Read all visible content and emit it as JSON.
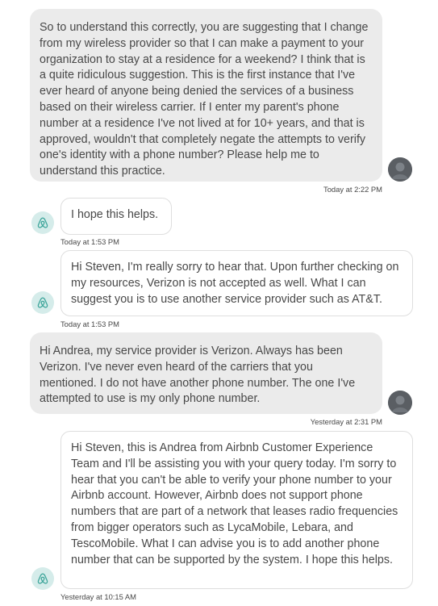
{
  "messages": [
    {
      "sender": "user",
      "text": "So to understand this correctly, you are suggesting that I change from my wireless provider so that I can make a payment to your organization to stay at a residence for a weekend? I think that is a quite ridiculous suggestion. This is the first instance that I've ever heard of anyone being denied the services of a business based on their wireless carrier. If I enter my parent's phone number at a residence I've not lived at for 10+ years, and that is approved, wouldn't that completely negate the attempts to verify one's identity with a phone number? Please help me to understand this practice.",
      "timestamp": "Today at 2:22 PM"
    },
    {
      "sender": "agent",
      "text": "I hope this helps.",
      "timestamp": "Today at 1:53 PM"
    },
    {
      "sender": "agent",
      "text": "Hi Steven, I'm really sorry to hear that. Upon further checking on my resources, Verizon is not accepted as well. What I can suggest you is to use another service provider such as AT&T.",
      "timestamp": "Today at 1:53 PM"
    },
    {
      "sender": "user",
      "text": "Hi Andrea, my service provider is Verizon. Always has been Verizon. I've never even heard of the carriers that you mentioned. I do not have another phone number. The one I've attempted to use is my only phone number.",
      "timestamp": "Yesterday at 2:31 PM"
    },
    {
      "sender": "agent",
      "text": "Hi Steven, this is Andrea from Airbnb Customer Experience Team and I'll be assisting you with your query today. I'm sorry to hear that you can't be able to verify your phone number to your Airbnb account. However, Airbnb does not support phone numbers that are part of a network that leases radio frequencies from bigger operators such as LycaMobile, Lebara, and TescoMobile. What I can advise you is to add another phone number that can be supported by the system. I hope this helps.",
      "timestamp": "Yesterday at 10:15 AM"
    }
  ],
  "avatars": {
    "user_icon": "user-profile-photo",
    "agent_icon": "airbnb-belo-logo-icon"
  },
  "colors": {
    "user_bubble_bg": "#ebebeb",
    "agent_bubble_border": "#dedede",
    "agent_avatar_bg": "#d5ecea",
    "agent_avatar_logo": "#3fa69b",
    "text": "#484848"
  }
}
